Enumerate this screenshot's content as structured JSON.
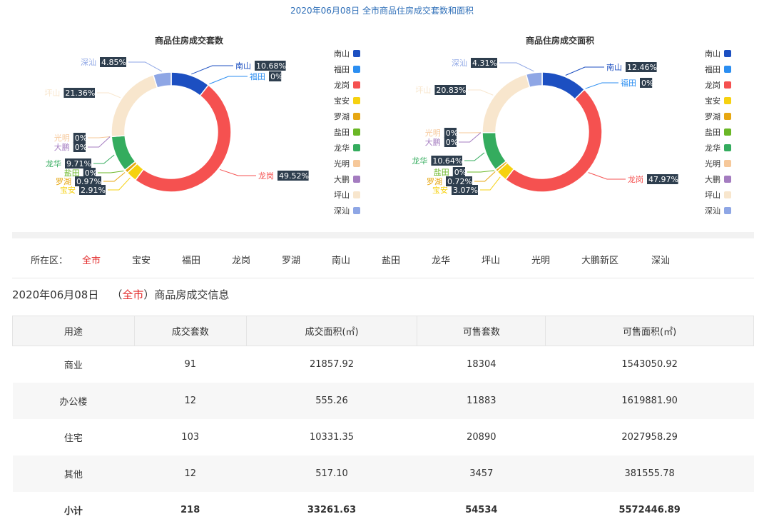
{
  "header": {
    "title": "2020年06月08日 全市商品住房成交套数和面积"
  },
  "legend_colors": {
    "南山": "#1c4fc1",
    "福田": "#2b8ef1",
    "龙岗": "#f55150",
    "宝安": "#f6d110",
    "罗湖": "#e7a712",
    "盐田": "#6ab726",
    "龙华": "#34ac5e",
    "光明": "#f6c89a",
    "大鹏": "#a47cc0",
    "坪山": "#f8e6cd",
    "深汕": "#8ea6e5"
  },
  "chart_data": [
    {
      "type": "pie",
      "title": "商品住房成交套数",
      "legend": [
        "南山",
        "福田",
        "龙岗",
        "宝安",
        "罗湖",
        "盐田",
        "龙华",
        "光明",
        "大鹏",
        "坪山",
        "深汕"
      ],
      "slices": [
        {
          "name": "南山",
          "label": "10.68%",
          "value": 10.68
        },
        {
          "name": "福田",
          "label": "0%",
          "value": 0
        },
        {
          "name": "龙岗",
          "label": "49.52%",
          "value": 49.52
        },
        {
          "name": "宝安",
          "label": "2.91%",
          "value": 2.91
        },
        {
          "name": "罗湖",
          "label": "0.97%",
          "value": 0.97
        },
        {
          "name": "盐田",
          "label": "0%",
          "value": 0
        },
        {
          "name": "龙华",
          "label": "9.71%",
          "value": 9.71
        },
        {
          "name": "光明",
          "label": "0%",
          "value": 0
        },
        {
          "name": "大鹏",
          "label": "0%",
          "value": 0
        },
        {
          "name": "坪山",
          "label": "21.36%",
          "value": 21.36
        },
        {
          "name": "深汕",
          "label": "4.85%",
          "value": 4.85
        }
      ]
    },
    {
      "type": "pie",
      "title": "商品住房成交面积",
      "legend": [
        "南山",
        "福田",
        "龙岗",
        "宝安",
        "罗湖",
        "盐田",
        "龙华",
        "光明",
        "大鹏",
        "坪山",
        "深汕"
      ],
      "slices": [
        {
          "name": "南山",
          "label": "12.46%",
          "value": 12.46
        },
        {
          "name": "福田",
          "label": "0%",
          "value": 0
        },
        {
          "name": "龙岗",
          "label": "47.97%",
          "value": 47.97
        },
        {
          "name": "宝安",
          "label": "3.07%",
          "value": 3.07
        },
        {
          "name": "罗湖",
          "label": "0.72%",
          "value": 0.72
        },
        {
          "name": "盐田",
          "label": "0%",
          "value": 0
        },
        {
          "name": "龙华",
          "label": "10.64%",
          "value": 10.64
        },
        {
          "name": "光明",
          "label": "0%",
          "value": 0
        },
        {
          "name": "大鹏",
          "label": "0%",
          "value": 0
        },
        {
          "name": "坪山",
          "label": "20.83%",
          "value": 20.83
        },
        {
          "name": "深汕",
          "label": "4.31%",
          "value": 4.31
        }
      ]
    }
  ],
  "filter": {
    "label": "所在区：",
    "items": [
      "全市",
      "宝安",
      "福田",
      "龙岗",
      "罗湖",
      "南山",
      "盐田",
      "龙华",
      "坪山",
      "光明",
      "大鹏新区",
      "深汕"
    ],
    "active": "全市"
  },
  "info": {
    "date": "2020年06月08日",
    "open_paren": "（",
    "district": "全市",
    "close_paren": "）",
    "suffix": "商品房成交信息"
  },
  "table": {
    "headers": [
      "用途",
      "成交套数",
      "成交面积(㎡)",
      "可售套数",
      "可售面积(㎡)"
    ],
    "rows": [
      [
        "商业",
        "91",
        "21857.92",
        "18304",
        "1543050.92"
      ],
      [
        "办公楼",
        "12",
        "555.26",
        "11883",
        "1619881.90"
      ],
      [
        "住宅",
        "103",
        "10331.35",
        "20890",
        "2027958.29"
      ],
      [
        "其他",
        "12",
        "517.10",
        "3457",
        "381555.78"
      ],
      [
        "小计",
        "218",
        "33261.63",
        "54534",
        "5572446.89"
      ]
    ]
  }
}
